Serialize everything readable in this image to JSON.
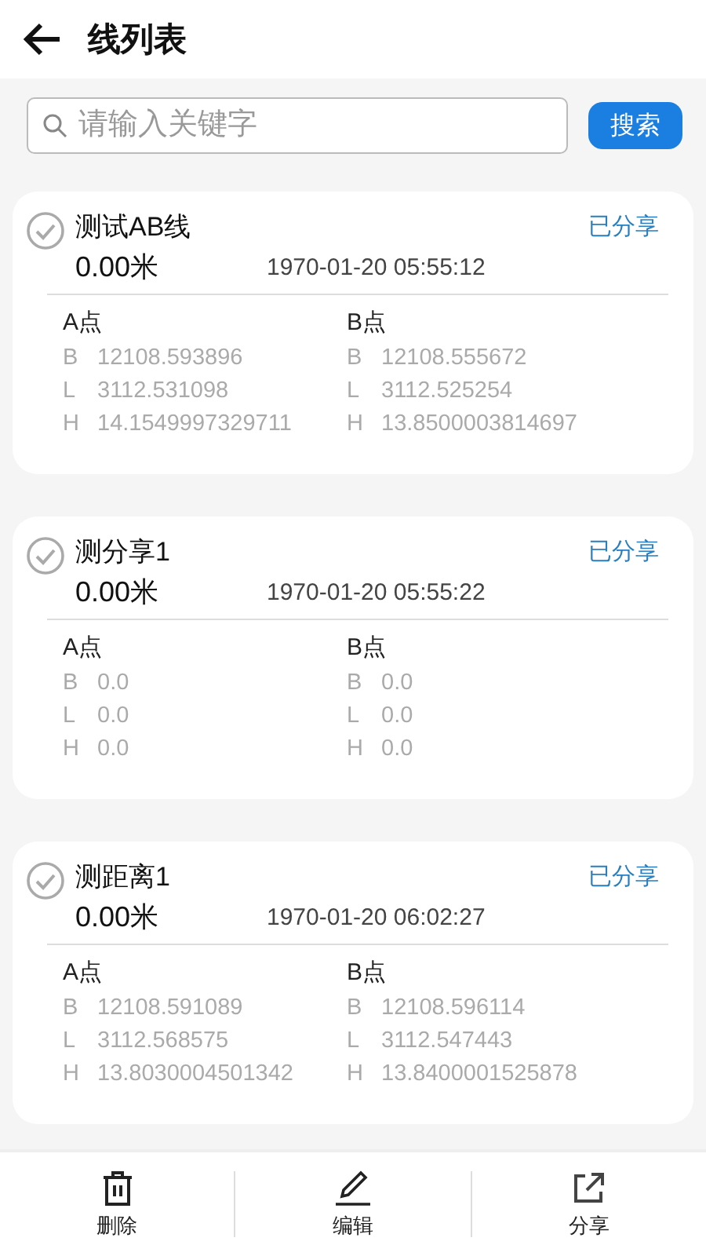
{
  "header": {
    "title": "线列表"
  },
  "search": {
    "placeholder": "请输入关键字",
    "button": "搜索"
  },
  "lines": [
    {
      "name": "测试AB线",
      "checked": false,
      "status": "已分享",
      "length": "0.00米",
      "time": "1970-01-20 05:55:12",
      "points": [
        {
          "label": "A点",
          "coords": [
            {
              "axis": "B",
              "value": "12108.593896"
            },
            {
              "axis": "L",
              "value": "3112.531098"
            },
            {
              "axis": "H",
              "value": "14.1549997329711"
            }
          ]
        },
        {
          "label": "B点",
          "coords": [
            {
              "axis": "B",
              "value": "12108.555672"
            },
            {
              "axis": "L",
              "value": "3112.525254"
            },
            {
              "axis": "H",
              "value": "13.8500003814697"
            }
          ]
        }
      ]
    },
    {
      "name": "测分享1",
      "checked": false,
      "status": "已分享",
      "length": "0.00米",
      "time": "1970-01-20 05:55:22",
      "points": [
        {
          "label": "A点",
          "coords": [
            {
              "axis": "B",
              "value": "0.0"
            },
            {
              "axis": "L",
              "value": "0.0"
            },
            {
              "axis": "H",
              "value": "0.0"
            }
          ]
        },
        {
          "label": "B点",
          "coords": [
            {
              "axis": "B",
              "value": "0.0"
            },
            {
              "axis": "L",
              "value": "0.0"
            },
            {
              "axis": "H",
              "value": "0.0"
            }
          ]
        }
      ]
    },
    {
      "name": "测距离1",
      "checked": false,
      "status": "已分享",
      "length": "0.00米",
      "time": "1970-01-20 06:02:27",
      "points": [
        {
          "label": "A点",
          "coords": [
            {
              "axis": "B",
              "value": "12108.591089"
            },
            {
              "axis": "L",
              "value": "3112.568575"
            },
            {
              "axis": "H",
              "value": "13.8030004501342"
            }
          ]
        },
        {
          "label": "B点",
          "coords": [
            {
              "axis": "B",
              "value": "12108.596114"
            },
            {
              "axis": "L",
              "value": "3112.547443"
            },
            {
              "axis": "H",
              "value": "13.8400001525878"
            }
          ]
        }
      ]
    }
  ],
  "toolbar": [
    {
      "label": "删除",
      "kind": "delete"
    },
    {
      "label": "编辑",
      "kind": "edit"
    },
    {
      "label": "分享",
      "kind": "share"
    }
  ]
}
